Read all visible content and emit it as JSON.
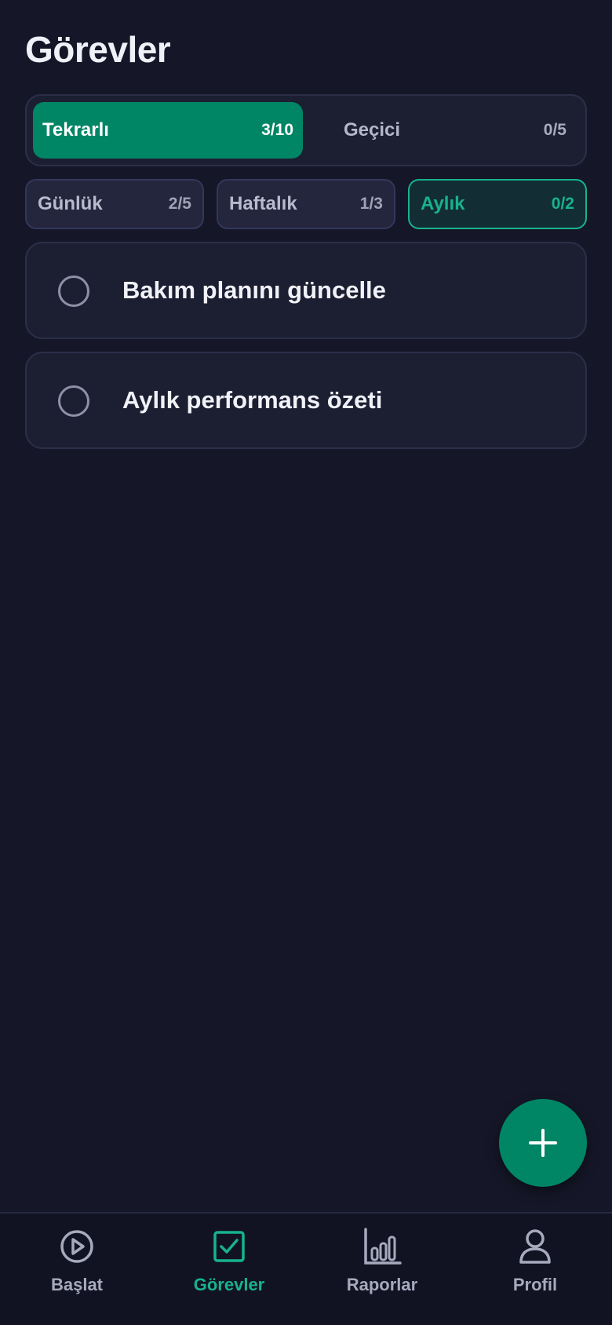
{
  "header": {
    "title": "Görevler"
  },
  "main_tabs": [
    {
      "label": "Tekrarlı",
      "count": "3/10",
      "active": true
    },
    {
      "label": "Geçici",
      "count": "0/5",
      "active": false
    }
  ],
  "frequency_tabs": [
    {
      "label": "Günlük",
      "count": "2/5",
      "active": false
    },
    {
      "label": "Haftalık",
      "count": "1/3",
      "active": false
    },
    {
      "label": "Aylık",
      "count": "0/2",
      "active": true
    }
  ],
  "tasks": [
    {
      "title": "Bakım planını güncelle",
      "done": false
    },
    {
      "title": "Aylık performans özeti",
      "done": false
    }
  ],
  "fab": {
    "icon": "plus-icon"
  },
  "bottom_nav": [
    {
      "label": "Başlat",
      "icon": "play-circle-icon",
      "active": false
    },
    {
      "label": "Görevler",
      "icon": "checkbox-icon",
      "active": true
    },
    {
      "label": "Raporlar",
      "icon": "bar-chart-icon",
      "active": false
    },
    {
      "label": "Profil",
      "icon": "person-icon",
      "active": false
    }
  ],
  "colors": {
    "background": "#151728",
    "card": "#1c1e32",
    "accent": "#008565",
    "accent_text": "#17b38d",
    "muted_text": "#a7aabd"
  }
}
